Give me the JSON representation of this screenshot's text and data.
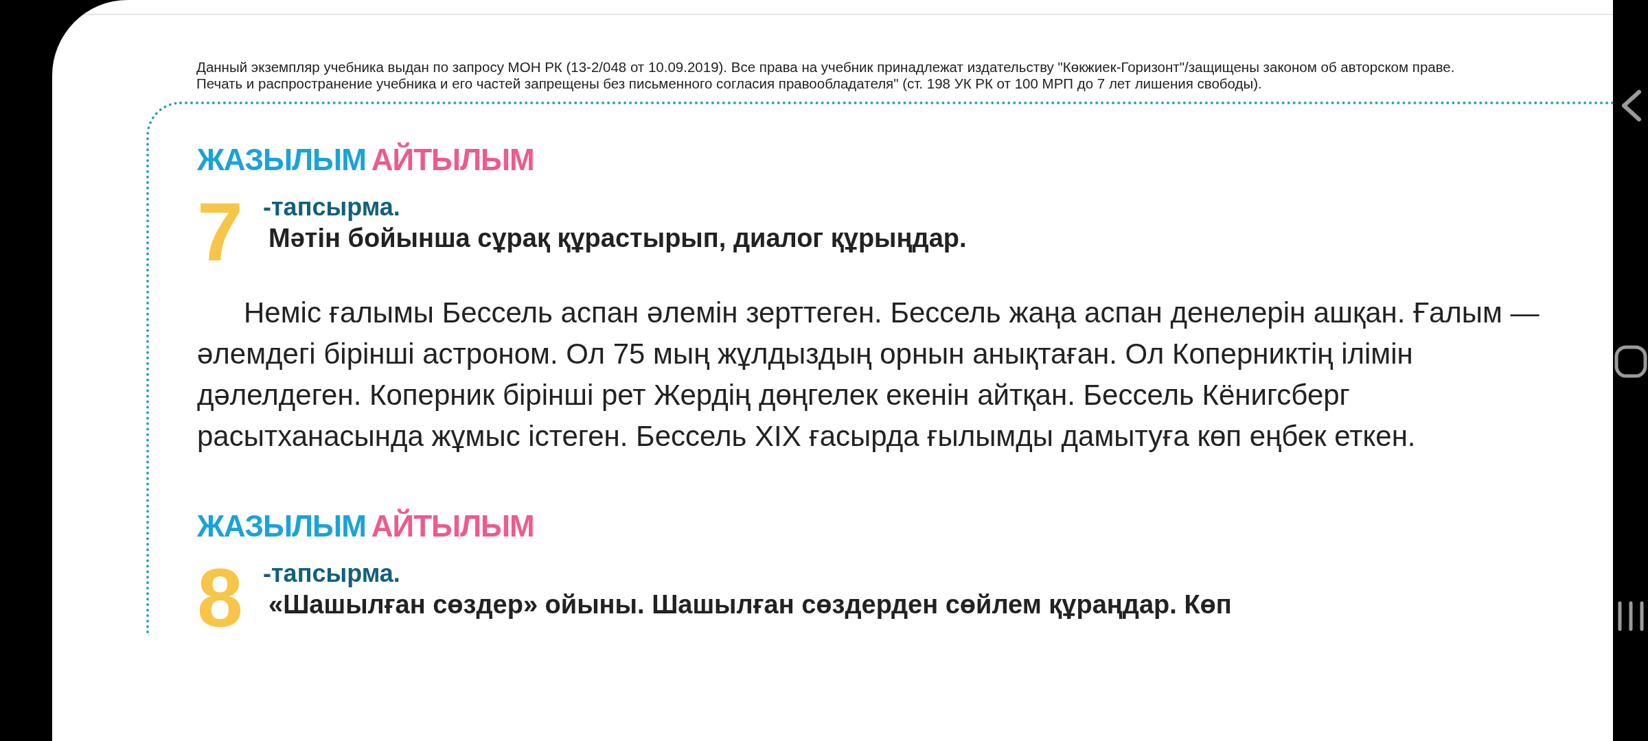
{
  "notice": [
    "Данный экземпляр учебника выдан по запросу МОН РК (13-2/048 от 10.09.2019). Все права на учебник принадлежат издательству \"Көкжиек-Горизонт\"/защищены законом об авторском праве.",
    "Печать и распространение учебника и его частей запрещены без письменного согласия правообладателя\" (ст. 198 УК РК от 100 МРП до 7 лет лишения свободы)."
  ],
  "sections": [
    {
      "skills": [
        {
          "label": "ЖАЗЫЛЫМ",
          "color": "#1aa3d8"
        },
        {
          "label": "АЙТЫЛЫМ",
          "color": "#ec5b8f"
        }
      ],
      "number": "7",
      "task_label": "-тапсырма.",
      "instruction": "Мәтін бойынша сұрақ құрастырып, диалог құрыңдар.",
      "body": "Неміс ғалымы Бессель аспан әлемін зерттеген. Бессель жаңа аспан денелерін ашқан. Ғалым — әлемдегі бірінші астроном. Ол 75 мың жұлдыздың орнын анықтаған. Ол Коперниктің ілімін дәлелдеген. Коперник бірінші рет Жердің дөңгелек екенін айтқан. Бессель Кёнигсберг расытханасында жұмыс істеген. Бессель XIX ғасырда ғылымды дамытуға көп еңбек еткен."
    },
    {
      "skills": [
        {
          "label": "ЖАЗЫЛЫМ",
          "color": "#1aa3d8"
        },
        {
          "label": "АЙТЫЛЫМ",
          "color": "#ec5b8f"
        }
      ],
      "number": "8",
      "task_label": "-тапсырма.",
      "instruction": "«Шашылған сөздер» ойыны. Шашылған сөздерден сөйлем құраңдар. Көп"
    }
  ]
}
